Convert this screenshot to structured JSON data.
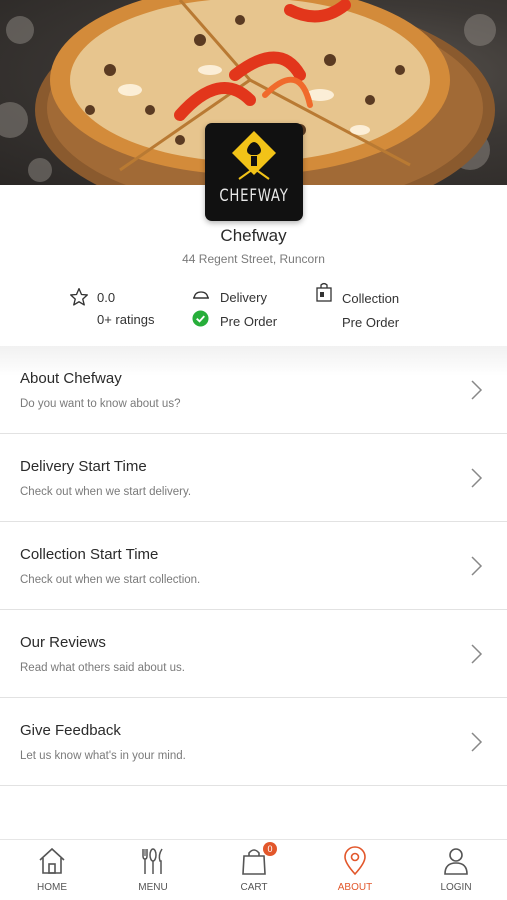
{
  "store": {
    "logo_text": "CHEFWAY",
    "name": "Chefway",
    "address": "44 Regent Street, Runcorn"
  },
  "stats": {
    "rating": "0.0",
    "ratings_count": "0+ ratings",
    "delivery_label": "Delivery",
    "delivery_preorder": "Pre Order",
    "collection_label": "Collection",
    "collection_preorder": "Pre Order"
  },
  "menu": [
    {
      "title": "About Chefway",
      "subtitle": "Do you want to know about us?"
    },
    {
      "title": "Delivery Start Time",
      "subtitle": "Check out when we start delivery."
    },
    {
      "title": "Collection Start Time",
      "subtitle": "Check out when we start collection."
    },
    {
      "title": "Our Reviews",
      "subtitle": "Read what others said about us."
    },
    {
      "title": "Give Feedback",
      "subtitle": "Let us know what's in your mind."
    }
  ],
  "tabs": {
    "home": "HOME",
    "menu": "MENU",
    "cart": "CART",
    "cart_count": "0",
    "about": "ABOUT",
    "login": "LOGIN"
  },
  "colors": {
    "accent": "#e2572b",
    "check_green": "#27ae3a",
    "logo_gold": "#f2c318"
  }
}
